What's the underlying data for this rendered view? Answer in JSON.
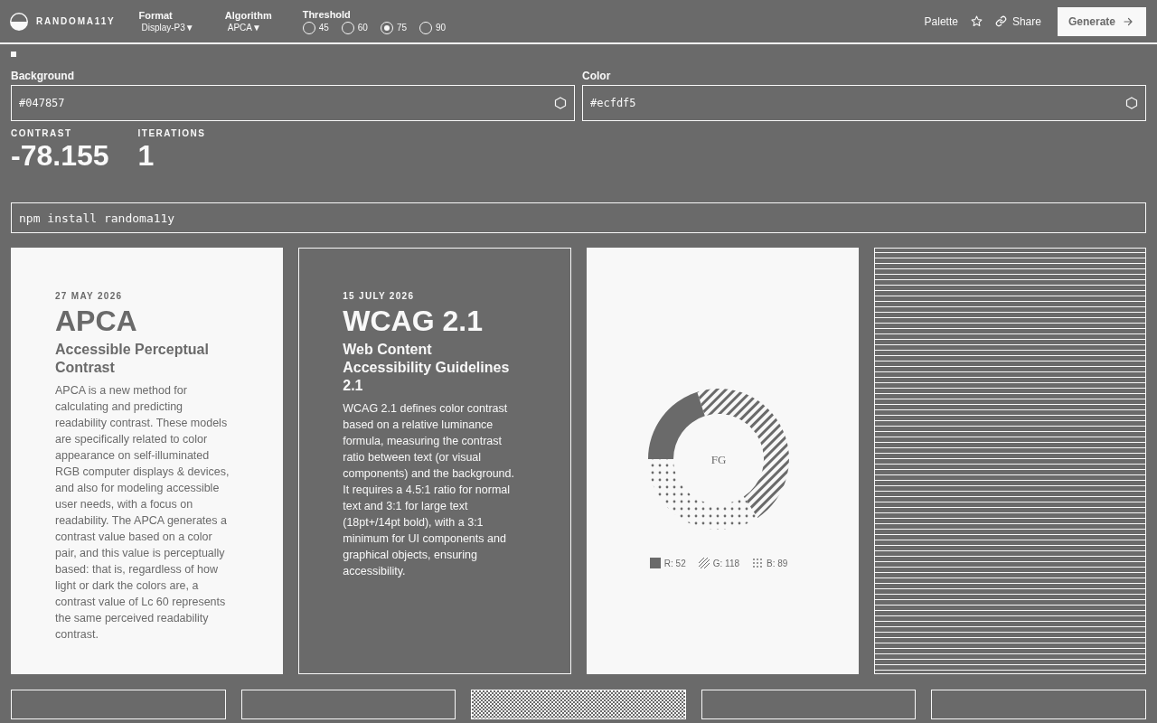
{
  "header": {
    "brand": "RANDOMA11Y",
    "selects": [
      {
        "label": "Format",
        "value": "Display-P3▼"
      },
      {
        "label": "Algorithm",
        "value": "APCA▼"
      }
    ],
    "threshold": {
      "label": "Threshold",
      "options": [
        {
          "label": "45",
          "selected": false
        },
        {
          "label": "60",
          "selected": false
        },
        {
          "label": "75",
          "selected": true
        },
        {
          "label": "90",
          "selected": false
        }
      ]
    },
    "palette": "Palette",
    "share": "Share",
    "generate": "Generate"
  },
  "fields": [
    {
      "label": "Background",
      "value": "#047857"
    },
    {
      "label": "Color",
      "value": "#ecfdf5"
    }
  ],
  "stats": [
    {
      "label": "CONTRAST",
      "value": "-78.155"
    },
    {
      "label": "ITERATIONS",
      "value": "1"
    }
  ],
  "install": {
    "value": "npm install randoma11y"
  },
  "cards": [
    {
      "kind": "article",
      "inverted": false,
      "date": "27 MAY 2026",
      "title": "APCA",
      "subtitle": "Accessible Perceptual Contrast",
      "body": "APCA is a new method for calculating and predicting readability contrast. These models are specifically related to color appearance on self-illuminated RGB computer displays & devices, and also for modeling accessible user needs, with a focus on readability. The APCA generates a contrast value based on a color pair, and this value is perceptually based: that is, regardless of how light or dark the colors are, a contrast value of Lc 60 represents the same perceived readability contrast."
    },
    {
      "kind": "article",
      "inverted": true,
      "date": "15 JULY 2026",
      "title": "WCAG 2.1",
      "subtitle": "Web Content Accessibility Guidelines 2.1",
      "body": "WCAG 2.1 defines color contrast based on a relative luminance formula, measuring the contrast ratio between text (or visual components) and the background. It requires a 4.5:1 ratio for normal text and 3:1 for large text (18pt+/14pt bold), with a 3:1 minimum for UI components and graphical objects, ensuring accessibility."
    },
    {
      "kind": "chart",
      "center": "FG",
      "legend": [
        {
          "kind": "solid"
        },
        {
          "kind": "hatch"
        },
        {
          "kind": "dots"
        }
      ],
      "chart_data": {
        "type": "donut",
        "categories": [
          "R: 52",
          "G: 118",
          "B: 89"
        ],
        "values": [
          52,
          118,
          89
        ]
      }
    },
    {
      "kind": "stripes"
    }
  ],
  "bottom_cards": [
    {
      "kind": "outline"
    },
    {
      "kind": "outline"
    },
    {
      "kind": "checker"
    },
    {
      "kind": "outline"
    },
    {
      "kind": "outline"
    }
  ]
}
